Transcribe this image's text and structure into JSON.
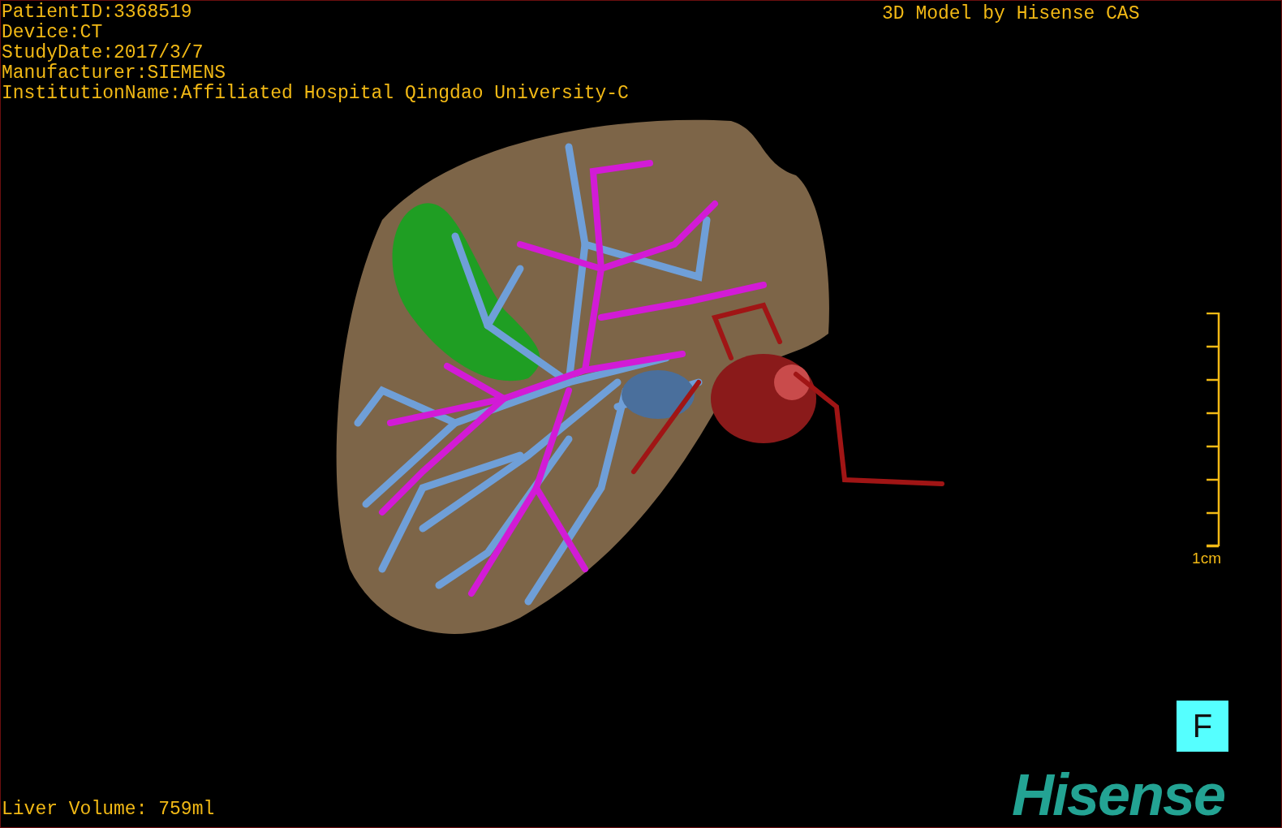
{
  "patient_info": [
    "PatientID:3368519",
    "Device:CT",
    "StudyDate:2017/3/7",
    "Manufacturer:SIEMENS",
    "InstitutionName:Affiliated Hospital Qingdao University-C"
  ],
  "model_credit": "3D Model by Hisense CAS",
  "scale_bar": {
    "label": "1cm"
  },
  "orientation_button": "F",
  "liver_volume": "Liver Volume: 759ml",
  "logo": "Hisense"
}
